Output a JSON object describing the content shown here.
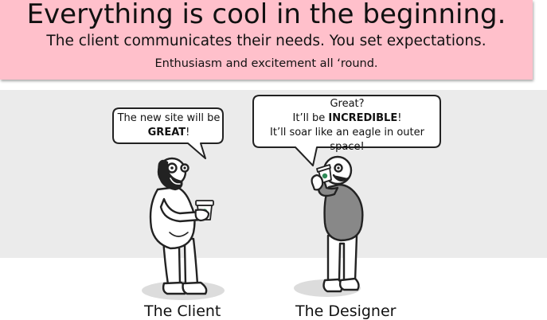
{
  "banner": {
    "headline": "Everything is cool in the beginning.",
    "line1": "The client communicates their needs.  You set expectations.",
    "line2": "Enthusiasm and excitement all ‘round.",
    "color": "#ffc0cb"
  },
  "client": {
    "speech_line1": "The new site will be",
    "speech_bold": "GREAT",
    "speech_end": "!",
    "caption": "The Client"
  },
  "designer": {
    "speech_line1": "Great?",
    "speech_line2_pre": "It’ll be ",
    "speech_line2_bold": "INCREDIBLE",
    "speech_line2_end": "!",
    "speech_line3": "It’ll soar like an eagle in outer space!",
    "caption": "The Designer"
  },
  "colors": {
    "stage": "#ebebeb",
    "designer_shirt": "#888888",
    "cup_sleeve": "#2e8b57"
  }
}
